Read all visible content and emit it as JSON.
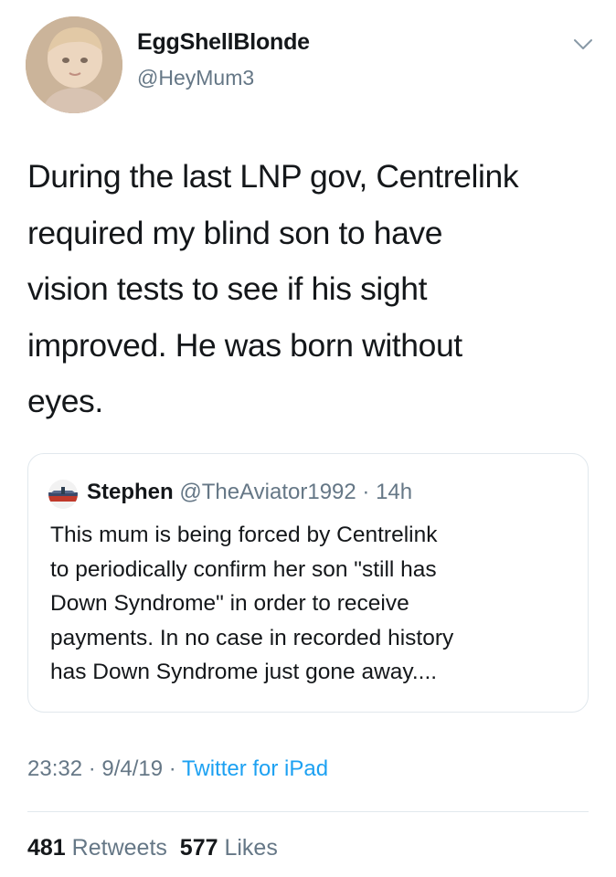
{
  "tweet": {
    "author": {
      "display_name": "EggShellBlonde",
      "handle": "@HeyMum3",
      "avatar_icon": "baby-photo-avatar"
    },
    "menu_icon": "chevron-down-icon",
    "text_lines": [
      "During the last LNP gov, Centrelink",
      "required my blind son to have",
      "vision tests to see if his sight",
      "improved. He was born without",
      "eyes."
    ],
    "quoted": {
      "avatar_icon": "aircraft-avatar",
      "name": "Stephen",
      "handle": "@TheAviator1992",
      "separator": " · ",
      "age": "14h",
      "text_lines": [
        "This mum is being forced by Centrelink",
        "to periodically confirm her son \"still has",
        "Down Syndrome\" in order to receive",
        "payments. In no case in recorded history",
        "has Down Syndrome just gone away...."
      ]
    },
    "time": "23:32",
    "date": "9/4/19",
    "dot": " · ",
    "source": "Twitter for iPad",
    "retweets_count": "481",
    "retweets_label": "Retweets",
    "likes_count": "577",
    "likes_label": "Likes"
  },
  "colors": {
    "text": "#14171a",
    "secondary": "#657786",
    "link": "#1da1f2",
    "border": "#e1e8ed"
  }
}
